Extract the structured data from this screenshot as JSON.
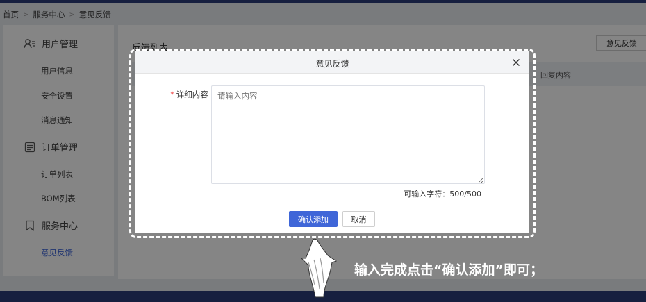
{
  "breadcrumb": {
    "home": "首页",
    "service_center": "服务中心",
    "current": "意见反馈"
  },
  "sidebar": {
    "groups": [
      {
        "label": "用户管理",
        "icon": "user-list-icon",
        "items": [
          "用户信息",
          "安全设置",
          "消息通知"
        ]
      },
      {
        "label": "订单管理",
        "icon": "order-form-icon",
        "items": [
          "订单列表",
          "BOM列表"
        ]
      },
      {
        "label": "服务中心",
        "icon": "bookmark-icon",
        "items": [
          "意见反馈"
        ]
      }
    ],
    "active_item": "意见反馈"
  },
  "main": {
    "title": "反馈列表",
    "feedback_button": "意见反馈",
    "table": {
      "columns": [
        "回复内容"
      ]
    }
  },
  "dialog": {
    "title": "意见反馈",
    "field_label": "详细内容",
    "required_mark": "*",
    "placeholder": "请输入内容",
    "counter_text": "可输入字符：500/500",
    "confirm_label": "确认添加",
    "cancel_label": "取消"
  },
  "annotation": {
    "text": "输入完成点击“确认添加”即可；",
    "icon": "pointing-hand-icon"
  },
  "colors": {
    "accent": "#3f66d8",
    "topbar": "#2b3d7a",
    "required": "#ee3333"
  }
}
